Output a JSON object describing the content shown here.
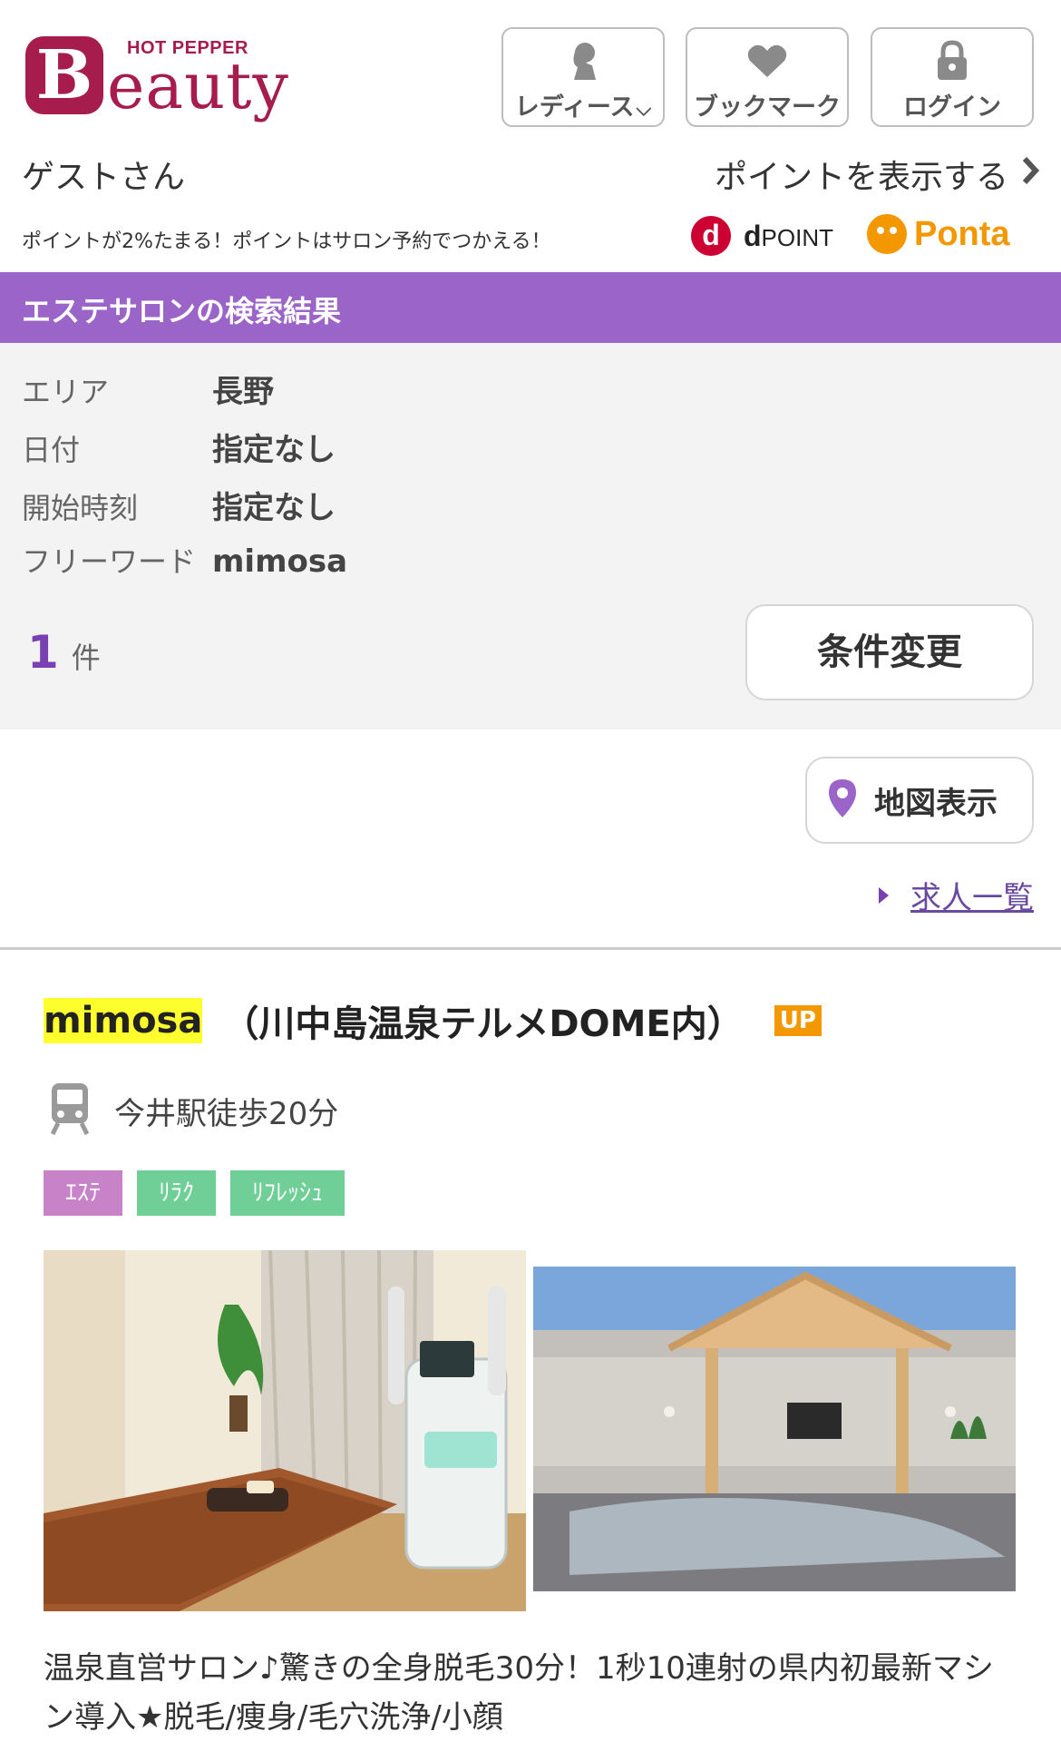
{
  "header": {
    "logo_small": "HOT PEPPER",
    "logo_big_letter": "B",
    "logo_rest": "eauty",
    "buttons": [
      {
        "label": "レディース",
        "icon": "lady-icon"
      },
      {
        "label": "ブックマーク",
        "icon": "heart-icon"
      },
      {
        "label": "ログイン",
        "icon": "lock-icon"
      }
    ],
    "guest": "ゲストさん",
    "points_link": "ポイントを表示する",
    "promo": "ポイントが2%たまる！ポイントはサロン予約でつかえる！",
    "dpoint_logo": "d",
    "dpoint_label_prefix": "d",
    "dpoint_label": "POINT",
    "ponta_label": "Ponta"
  },
  "results_bar": {
    "title": "エステサロンの検索結果"
  },
  "conditions": {
    "rows": [
      {
        "key": "エリア",
        "value": "長野"
      },
      {
        "key": "日付",
        "value": "指定なし"
      },
      {
        "key": "開始時刻",
        "value": "指定なし"
      },
      {
        "key": "フリーワード",
        "value": "mimosa"
      }
    ],
    "count": "1",
    "count_unit": "件",
    "change_button": "条件変更"
  },
  "map_button": "地図表示",
  "job_link": "求人一覧",
  "salon": {
    "name_highlight": "mimosa",
    "name_rest": "（川中島温泉テルメDOME内）",
    "badge": "UP",
    "station": "今井駅徒歩20分",
    "tags": [
      {
        "label": "ｴｽﾃ",
        "color": "#c883c8"
      },
      {
        "label": "ﾘﾗｸ",
        "color": "#6fcf97"
      },
      {
        "label": "ﾘﾌﾚｯｼｭ",
        "color": "#6fcf97"
      }
    ],
    "description": "温泉直営サロン♪驚きの全身脱毛30分！1秒10連射の県内初最新マシン導入★脱毛/痩身/毛穴洗浄/小顔"
  },
  "colors": {
    "brand": "#a51c4d",
    "accent_purple": "#9b64c8",
    "highlight": "#ffff2e",
    "up_badge": "#f39800"
  }
}
